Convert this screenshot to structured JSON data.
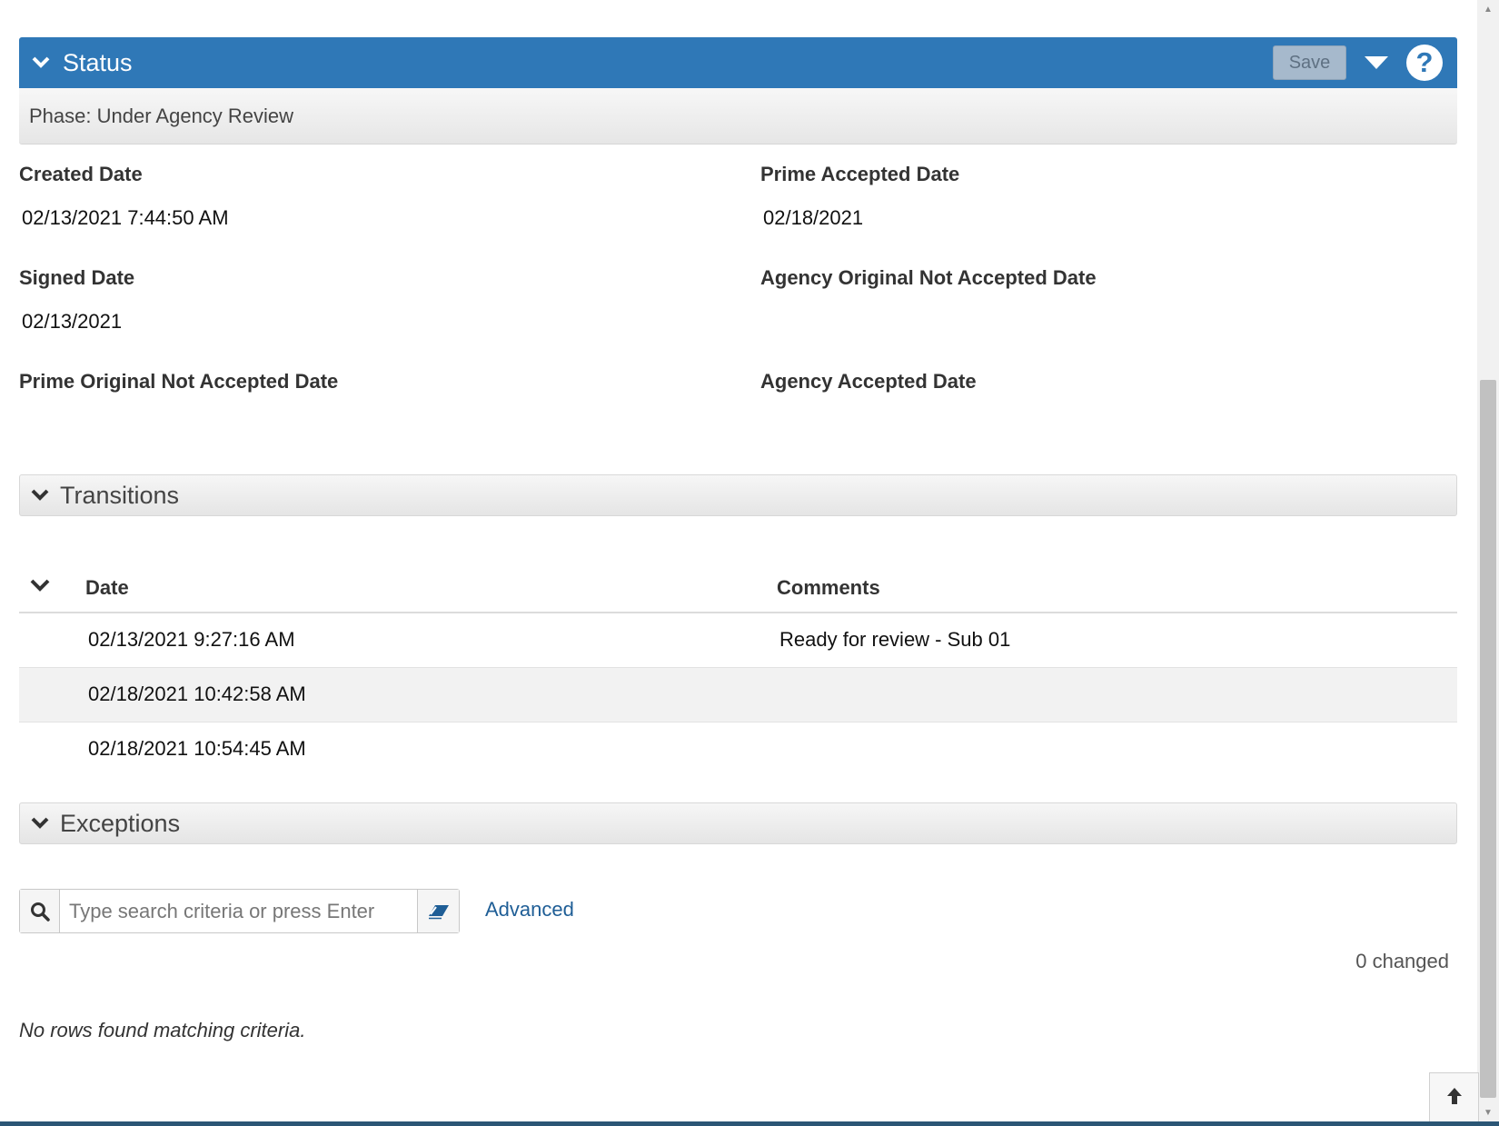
{
  "status_panel": {
    "title": "Status",
    "save_label": "Save",
    "help_symbol": "?",
    "phase": "Phase: Under Agency Review"
  },
  "fields": {
    "created_date": {
      "label": "Created Date",
      "value": "02/13/2021 7:44:50 AM"
    },
    "prime_accepted_date": {
      "label": "Prime Accepted Date",
      "value": "02/18/2021"
    },
    "signed_date": {
      "label": "Signed Date",
      "value": "02/13/2021"
    },
    "agency_original_not_accepted_date": {
      "label": "Agency Original Not Accepted Date",
      "value": ""
    },
    "prime_original_not_accepted_date": {
      "label": "Prime Original Not Accepted Date",
      "value": ""
    },
    "agency_accepted_date": {
      "label": "Agency Accepted Date",
      "value": ""
    }
  },
  "transitions": {
    "title": "Transitions",
    "columns": {
      "date": "Date",
      "comments": "Comments"
    },
    "rows": [
      {
        "date": "02/13/2021 9:27:16 AM",
        "comments": "Ready for review - Sub 01"
      },
      {
        "date": "02/18/2021 10:42:58 AM",
        "comments": ""
      },
      {
        "date": "02/18/2021 10:54:45 AM",
        "comments": ""
      }
    ]
  },
  "exceptions": {
    "title": "Exceptions",
    "search_placeholder": "Type search criteria or press Enter",
    "search_value": "",
    "advanced_label": "Advanced",
    "changed_text": "0 changed",
    "empty_message": "No rows found matching criteria."
  },
  "colors": {
    "header_blue": "#2f78b7",
    "link_blue": "#1f5e96"
  },
  "icons": [
    "chevron-down-icon",
    "dropdown-caret-icon",
    "help-icon",
    "search-icon",
    "eraser-icon",
    "arrow-up-icon"
  ]
}
